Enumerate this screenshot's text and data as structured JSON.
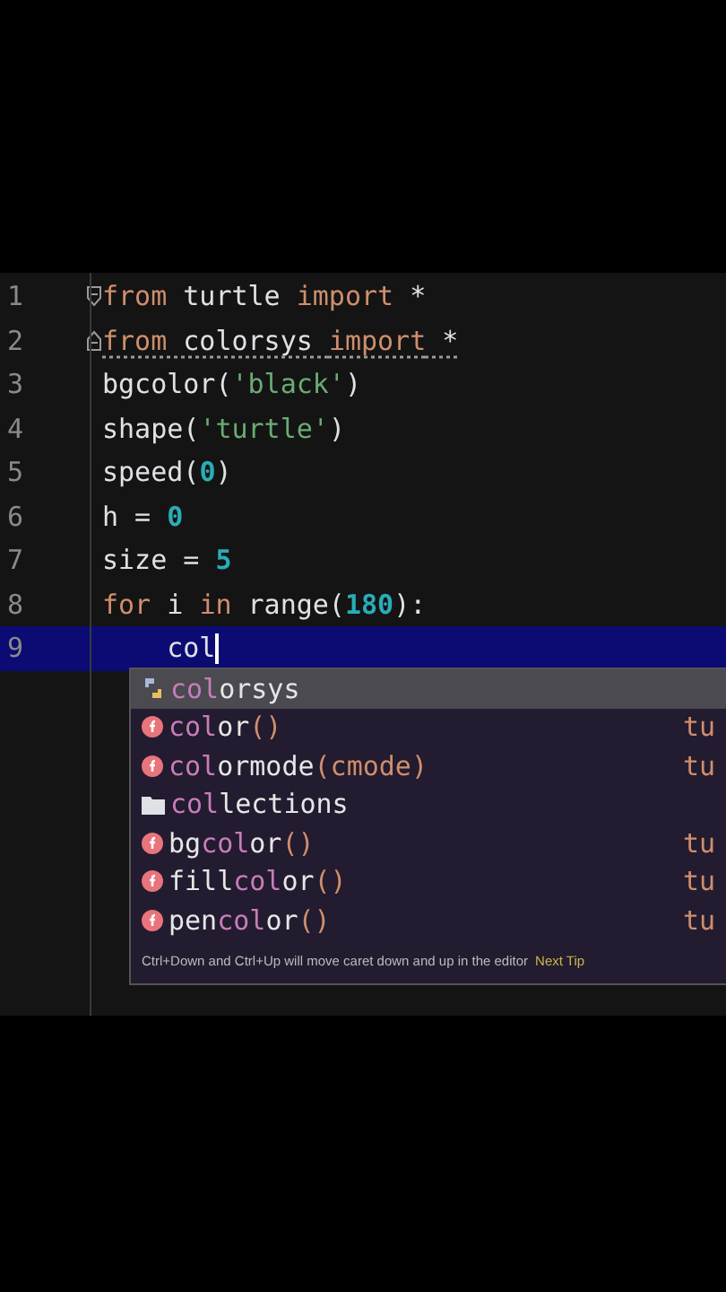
{
  "editor": {
    "lines": [
      {
        "number": "1",
        "kind": "opener",
        "warning": false,
        "selected": false,
        "tokens": [
          {
            "text": "from",
            "kind": "keyword"
          },
          {
            "text": " turtle ",
            "kind": "plain"
          },
          {
            "text": "import",
            "kind": "keyword"
          },
          {
            "text": " *",
            "kind": "plain"
          }
        ]
      },
      {
        "number": "2",
        "kind": "closer",
        "warning": true,
        "selected": false,
        "tokens": [
          {
            "text": "from",
            "kind": "keyword"
          },
          {
            "text": " colorsys ",
            "kind": "plain"
          },
          {
            "text": "import",
            "kind": "keyword"
          },
          {
            "text": " *",
            "kind": "plain"
          }
        ]
      },
      {
        "number": "3",
        "kind": "plain",
        "warning": false,
        "selected": false,
        "tokens": [
          {
            "text": "bgcolor(",
            "kind": "plain"
          },
          {
            "text": "'black'",
            "kind": "string"
          },
          {
            "text": ")",
            "kind": "plain"
          }
        ]
      },
      {
        "number": "4",
        "kind": "plain",
        "warning": false,
        "selected": false,
        "tokens": [
          {
            "text": "shape(",
            "kind": "plain"
          },
          {
            "text": "'turtle'",
            "kind": "string"
          },
          {
            "text": ")",
            "kind": "plain"
          }
        ]
      },
      {
        "number": "5",
        "kind": "plain",
        "warning": false,
        "selected": false,
        "tokens": [
          {
            "text": "speed(",
            "kind": "plain"
          },
          {
            "text": "0",
            "kind": "number"
          },
          {
            "text": ")",
            "kind": "plain"
          }
        ]
      },
      {
        "number": "6",
        "kind": "plain",
        "warning": false,
        "selected": false,
        "tokens": [
          {
            "text": "h = ",
            "kind": "plain"
          },
          {
            "text": "0",
            "kind": "number"
          }
        ]
      },
      {
        "number": "7",
        "kind": "plain",
        "warning": false,
        "selected": false,
        "tokens": [
          {
            "text": "size = ",
            "kind": "plain"
          },
          {
            "text": "5",
            "kind": "number"
          }
        ]
      },
      {
        "number": "8",
        "kind": "plain",
        "warning": false,
        "selected": false,
        "tokens": [
          {
            "text": "for",
            "kind": "keyword"
          },
          {
            "text": " i ",
            "kind": "plain"
          },
          {
            "text": "in",
            "kind": "keyword"
          },
          {
            "text": " range(",
            "kind": "plain"
          },
          {
            "text": "180",
            "kind": "number"
          },
          {
            "text": "):",
            "kind": "plain"
          }
        ]
      },
      {
        "number": "9",
        "kind": "plain",
        "warning": false,
        "selected": true,
        "tokens": [
          {
            "text": "    col",
            "kind": "plain"
          }
        ]
      }
    ]
  },
  "completion": {
    "items": [
      {
        "kind": "module",
        "selected": true,
        "parts": [
          {
            "text": "col",
            "matched": true
          },
          {
            "text": "orsys",
            "matched": false
          }
        ]
      },
      {
        "kind": "function",
        "selected": false,
        "parts": [
          {
            "text": "col",
            "matched": true
          },
          {
            "text": "or",
            "matched": false
          }
        ],
        "params": "()",
        "source": "tu"
      },
      {
        "kind": "function",
        "selected": false,
        "parts": [
          {
            "text": "col",
            "matched": true
          },
          {
            "text": "ormode",
            "matched": false
          }
        ],
        "params": "(cmode)",
        "source": "tu"
      },
      {
        "kind": "folder",
        "selected": false,
        "parts": [
          {
            "text": "col",
            "matched": true
          },
          {
            "text": "lections",
            "matched": false
          }
        ]
      },
      {
        "kind": "function",
        "selected": false,
        "parts": [
          {
            "text": "bg",
            "matched": false
          },
          {
            "text": "col",
            "matched": true
          },
          {
            "text": "or",
            "matched": false
          }
        ],
        "params": "()",
        "source": "tu"
      },
      {
        "kind": "function",
        "selected": false,
        "parts": [
          {
            "text": "fill",
            "matched": false
          },
          {
            "text": "col",
            "matched": true
          },
          {
            "text": "or",
            "matched": false
          }
        ],
        "params": "()",
        "source": "tu"
      },
      {
        "kind": "function",
        "selected": false,
        "parts": [
          {
            "text": "pen",
            "matched": false
          },
          {
            "text": "col",
            "matched": true
          },
          {
            "text": "or",
            "matched": false
          }
        ],
        "params": "()",
        "source": "tu"
      }
    ],
    "tip": "Ctrl+Down and Ctrl+Up will move caret down and up in the editor",
    "tip_link": "Next Tip"
  }
}
